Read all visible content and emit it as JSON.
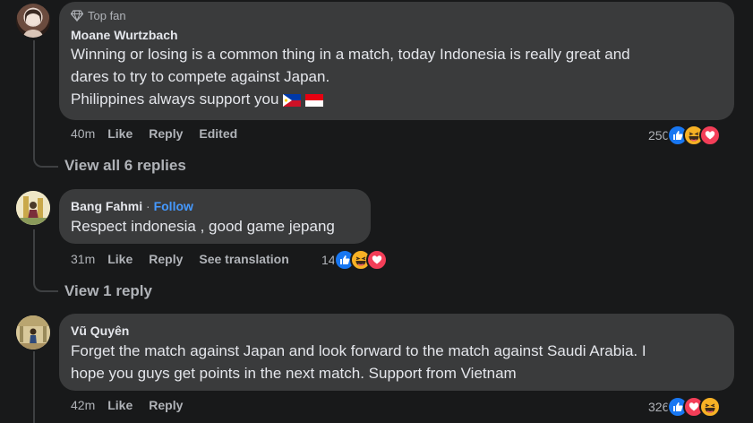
{
  "comments": [
    {
      "badge": "Top fan",
      "author": "Moane Wurtzbach",
      "text_line1": "Winning or losing is a common thing in a match, today Indonesia is really great and",
      "text_line2": "dares to try to compete against Japan.",
      "text_line3": "Philippines always support you",
      "time": "40m",
      "like": "Like",
      "reply": "Reply",
      "edited": "Edited",
      "reaction_count": "250",
      "replies_link": "View all 6 replies"
    },
    {
      "author": "Bang Fahmi",
      "separator": "·",
      "follow": "Follow",
      "text": "Respect indonesia , good game jepang",
      "time": "31m",
      "like": "Like",
      "reply": "Reply",
      "see_translation": "See translation",
      "reaction_count": "14",
      "replies_link": "View 1 reply"
    },
    {
      "author": "Vũ Quyên",
      "text_line1": "Forget the match against Japan and look forward to the match against Saudi Arabia. I",
      "text_line2": "hope you guys get points in the next match. Support from Vietnam",
      "time": "42m",
      "like": "Like",
      "reply": "Reply",
      "reaction_count": "326"
    }
  ],
  "colors": {
    "background": "#18191a",
    "bubble": "#3a3b3c",
    "secondary_text": "#b0b3b8",
    "link_blue": "#4599ff",
    "like_blue": "#1877f2",
    "love_red": "#f33e58",
    "haha_yellow": "#f7b125"
  },
  "icons": {
    "badge": "diamond-icon",
    "like": "like-reaction-icon",
    "haha": "haha-reaction-icon",
    "love": "love-reaction-icon"
  }
}
